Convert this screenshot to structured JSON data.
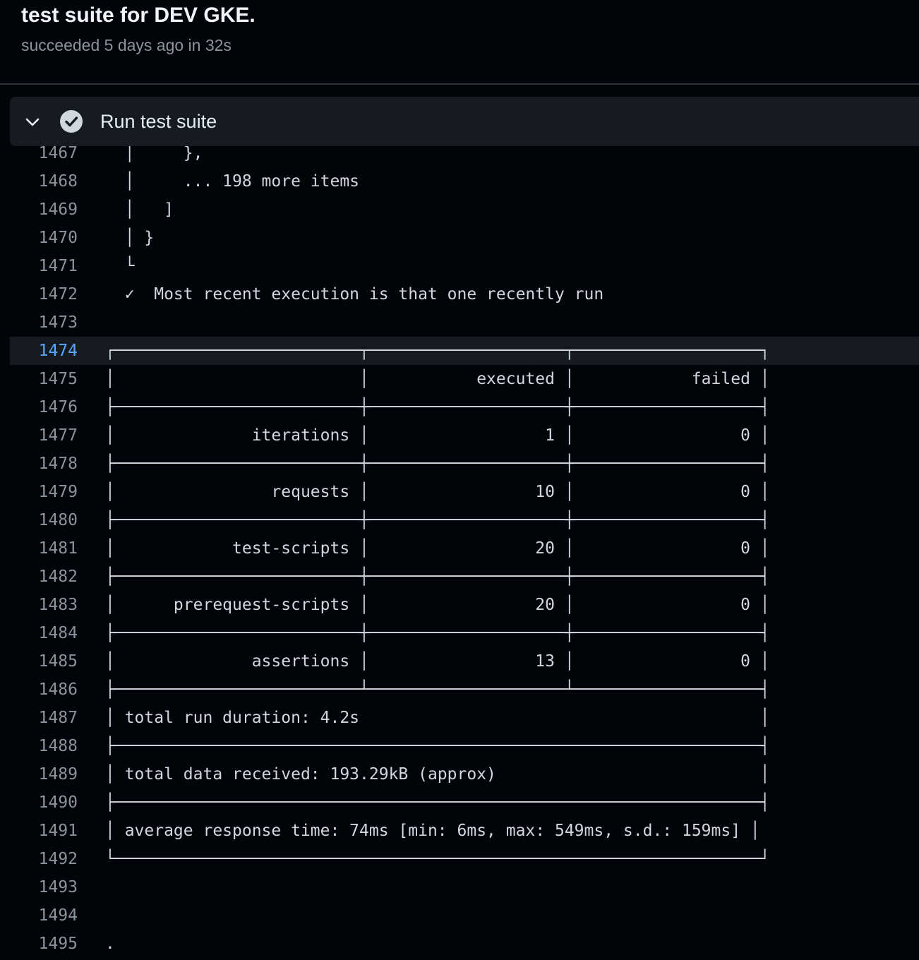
{
  "job": {
    "title": "test suite for DEV GKE.",
    "subtitle": "succeeded 5 days ago in 32s"
  },
  "step": {
    "title": "Run test suite",
    "status_icon": "check-circle-icon",
    "toggle_icon": "chevron-down-icon"
  },
  "colors": {
    "background": "#010409",
    "step_header": "#161b22",
    "line_number": "#8b949e",
    "selected_line_number": "#58a6ff",
    "text": "#d0d7de"
  },
  "log": {
    "selected_line": "1474",
    "lines": [
      {
        "n": "1467",
        "text": "  │     },"
      },
      {
        "n": "1468",
        "text": "  │     ... 198 more items"
      },
      {
        "n": "1469",
        "text": "  │   ]"
      },
      {
        "n": "1470",
        "text": "  │ }"
      },
      {
        "n": "1471",
        "text": "  └"
      },
      {
        "n": "1472",
        "text": "  ✓  Most recent execution is that one recently run"
      },
      {
        "n": "1473",
        "text": ""
      },
      {
        "n": "1474",
        "text": "┌─────────────────────────┬────────────────────┬───────────────────┐"
      },
      {
        "n": "1475",
        "text": "│                         │           executed │            failed │"
      },
      {
        "n": "1476",
        "text": "├─────────────────────────┼────────────────────┼───────────────────┤"
      },
      {
        "n": "1477",
        "text": "│              iterations │                  1 │                 0 │"
      },
      {
        "n": "1478",
        "text": "├─────────────────────────┼────────────────────┼───────────────────┤"
      },
      {
        "n": "1479",
        "text": "│                requests │                 10 │                 0 │"
      },
      {
        "n": "1480",
        "text": "├─────────────────────────┼────────────────────┼───────────────────┤"
      },
      {
        "n": "1481",
        "text": "│            test-scripts │                 20 │                 0 │"
      },
      {
        "n": "1482",
        "text": "├─────────────────────────┼────────────────────┼───────────────────┤"
      },
      {
        "n": "1483",
        "text": "│      prerequest-scripts │                 20 │                 0 │"
      },
      {
        "n": "1484",
        "text": "├─────────────────────────┼────────────────────┼───────────────────┤"
      },
      {
        "n": "1485",
        "text": "│              assertions │                 13 │                 0 │"
      },
      {
        "n": "1486",
        "text": "├─────────────────────────┴────────────────────┴───────────────────┤"
      },
      {
        "n": "1487",
        "text": "│ total run duration: 4.2s                                         │"
      },
      {
        "n": "1488",
        "text": "├──────────────────────────────────────────────────────────────────┤"
      },
      {
        "n": "1489",
        "text": "│ total data received: 193.29kB (approx)                           │"
      },
      {
        "n": "1490",
        "text": "├──────────────────────────────────────────────────────────────────┤"
      },
      {
        "n": "1491",
        "text": "│ average response time: 74ms [min: 6ms, max: 549ms, s.d.: 159ms] │"
      },
      {
        "n": "1492",
        "text": "└──────────────────────────────────────────────────────────────────┘"
      },
      {
        "n": "1493",
        "text": ""
      },
      {
        "n": "1494",
        "text": ""
      },
      {
        "n": "1495",
        "text": "."
      }
    ]
  }
}
